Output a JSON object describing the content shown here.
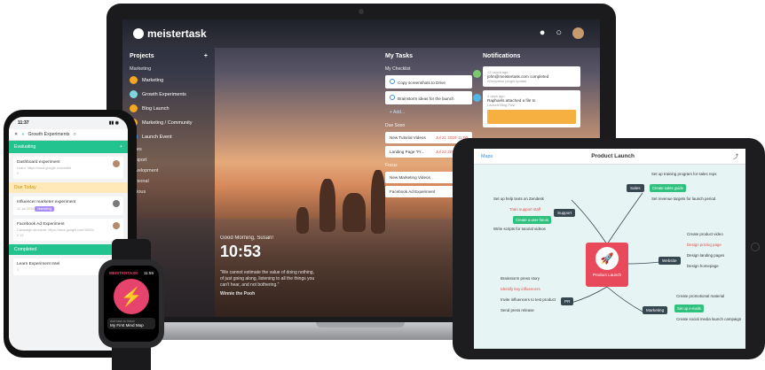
{
  "laptop": {
    "app_logo": "meistertask",
    "projects": {
      "header": "Projects",
      "add_icon": "+",
      "category": "Marketing",
      "items": [
        {
          "label": "Marketing",
          "color": "#f5a623"
        },
        {
          "label": "Growth Experiments",
          "color": "#7ed6df"
        },
        {
          "label": "Blog Launch",
          "color": "#f5a623"
        },
        {
          "label": "Marketing / Community",
          "color": "#f5a623"
        },
        {
          "label": "Launch Event",
          "color": "#3b8fe0"
        }
      ],
      "sections": [
        "Sales",
        "Support",
        "Development",
        "Personal",
        "Various"
      ]
    },
    "greeting": "Good Morning, Susan!",
    "clock": "10:53",
    "quote": "\"We cannot estimate the value of doing nothing, of just going along, listening to all the things you can't hear, and not bothering.\"",
    "quote_author": "Winnie the Pooh",
    "tasks": {
      "header": "My Tasks",
      "checklist_title": "My Checklist",
      "checklist": [
        "Copy screenshots to Drive",
        "Brainstorm ideas for the launch"
      ],
      "add_label": "+ Add...",
      "group_one": "Due Soon",
      "group_one_items": [
        {
          "label": "New Tutorial Videos",
          "due": "Jul 21 2019 11:00"
        },
        {
          "label": "Landing Page \"Fr...",
          "due": "Jul 22 2019 11:00"
        }
      ],
      "group_two": "Focus",
      "group_two_items": [
        "New Marketing Videos",
        "Facebook Ad Experiment"
      ]
    },
    "notifications": {
      "header": "Notifications",
      "items": [
        {
          "meta": "13 hours ago",
          "text": "john@meistertask.com completed",
          "sub": "Wordpress plugin update"
        },
        {
          "meta": "4 days ago",
          "text": "Raphaels attached a file to",
          "sub": "Launch Blog Post"
        }
      ]
    }
  },
  "iphone": {
    "status_time": "11:37",
    "status_icons": "▮▮ ◉",
    "nav_title": "Growth Experiments",
    "section_one": "Evaluating",
    "card_one": {
      "title": "Dashboard experiment",
      "sub": "Learn: https://docs.google.com/edit#",
      "meta": "2"
    },
    "due_header": "Due Today",
    "card_two": {
      "title": "Influencer marketer experiment",
      "date": "11 Jul 2019",
      "tag": "Marketing"
    },
    "card_three": {
      "title": "Facebook Ad Experiment",
      "sub": "Campaign structure: https://docs.google.com/3402c",
      "meta": "2   12"
    },
    "done_header": "Completed",
    "card_four": {
      "title": "Learn Experiment Intel",
      "meta": "1"
    }
  },
  "watch": {
    "app_name": "MEISTERTASK",
    "time": "11:55",
    "icon": "⚡",
    "caption_top": "Add task to Inbox",
    "caption_bottom": "My First Mind Map"
  },
  "ipad": {
    "left_label": "Maps",
    "title": "Product Launch",
    "center": "Product Launch",
    "rocket": "🚀",
    "branches": {
      "sales": "Sales",
      "support": "Support",
      "website": "Website",
      "pr": "PR",
      "marketing": "Marketing"
    },
    "nodes": {
      "sales": [
        "Set up training program for sales reps",
        "Create sales guide",
        "Set revenue targets for launch period"
      ],
      "support": [
        "Set up help texts on Zendesk",
        "Train support staff",
        "Create a user forum",
        "Write scripts for tutorial videos"
      ],
      "website": [
        "Create product video",
        "Design pricing page",
        "Design landing pages",
        "Design homepage"
      ],
      "pr": [
        "Brainstorm press story",
        "Identify key influencers",
        "Invite influencers to test product",
        "Send press release"
      ],
      "marketing": [
        "Create promotional material",
        "Set up e-mails",
        "Create social media launch campaign"
      ]
    }
  }
}
